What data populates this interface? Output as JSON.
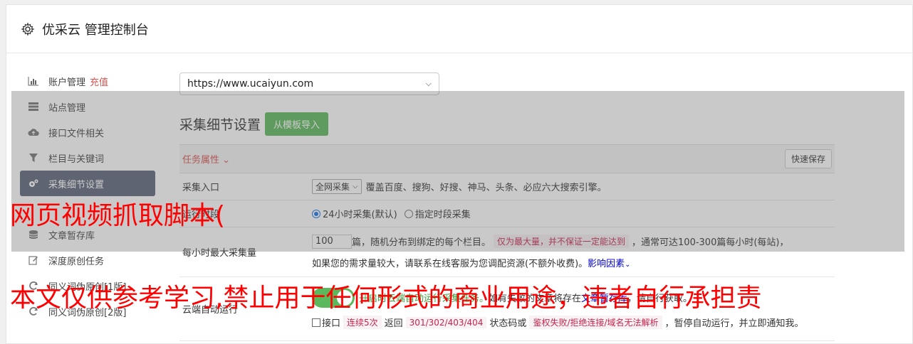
{
  "header": {
    "title": "优采云 管理控制台",
    "icon": "gear-icon"
  },
  "sidebar": {
    "items": [
      {
        "label": "账户管理",
        "badge": "充值",
        "icon": "bar-chart-icon"
      },
      {
        "label": "站点管理",
        "icon": "server-icon"
      },
      {
        "label": "接口文件相关",
        "icon": "cloud-upload-icon"
      },
      {
        "label": "栏目与关键词",
        "icon": "filter-icon"
      },
      {
        "label": "采集细节设置",
        "icon": "gears-icon",
        "active": true
      },
      {
        "label": "",
        "icon": "blank-icon"
      },
      {
        "label": "文章暂存库",
        "icon": "database-icon"
      },
      {
        "label": "深度原创任务",
        "icon": "edit-icon"
      },
      {
        "label": "同义词伪原创[1版]",
        "icon": "refresh-icon"
      },
      {
        "label": "同义词伪原创[2版]",
        "icon": "refresh-icon"
      }
    ]
  },
  "main": {
    "site_select": "https://www.ucaiyun.com",
    "section_title": "采集细节设置",
    "import_button": "从模板导入",
    "task_header": "任务属性",
    "save_button": "快速保存",
    "rows": {
      "entry": {
        "label": "采集入口",
        "select": "全网采集",
        "desc": "覆盖百度、搜狗、好搜、神马、头条、必应六大搜索引擎。"
      },
      "time": {
        "label": "运行时段",
        "opt1": "24小时采集(默认)",
        "opt2": "指定时段采集"
      },
      "max": {
        "label": "每小时最大采集量",
        "value": "100",
        "text1": "篇，随机分布到绑定的每个栏目。",
        "tag": "仅为最大量，并不保证一定能达到",
        "text2": "，通常可达100-300篇每小时(每站)，",
        "text3": "如果您的需求量较大，请联系在线客服为您调配资源(不额外收费)。",
        "link": "影响因素"
      },
      "cloud": {
        "label": "云端自动运行",
        "desc1": "开启时云端自动运行采集任务。",
        "desc2": "如有失败的文章将存在",
        "link": "文章暂存库",
        "desc3": "，请自行获取。",
        "cb_label": "接口",
        "tag1": "连续5次",
        "text1": "返回",
        "tag2": "301/302/403/404",
        "text2": "状态码或",
        "tag3": "鉴权失败/拒绝连接/域名无法解析",
        "text3": "，暂停自动运行，并立即通知我。"
      }
    }
  },
  "watermarks": {
    "line1": "网页视频抓取脚本(",
    "line2": "本文仅供参考学习,禁止用于任何形式的商业用途，违者自行承担责"
  }
}
